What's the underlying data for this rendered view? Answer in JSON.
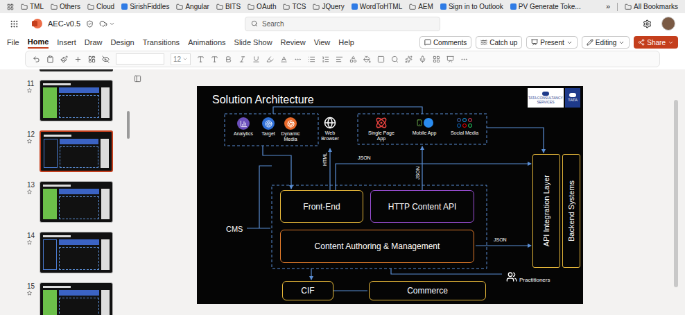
{
  "browser": {
    "bookmarks": [
      {
        "label": "TML",
        "kind": "folder"
      },
      {
        "label": "Others",
        "kind": "folder"
      },
      {
        "label": "Cloud",
        "kind": "folder"
      },
      {
        "label": "SirishFiddles",
        "kind": "site"
      },
      {
        "label": "Angular",
        "kind": "folder"
      },
      {
        "label": "BITS",
        "kind": "folder"
      },
      {
        "label": "OAuth",
        "kind": "folder"
      },
      {
        "label": "TCS",
        "kind": "folder"
      },
      {
        "label": "JQuery",
        "kind": "folder"
      },
      {
        "label": "WordToHTML",
        "kind": "site"
      },
      {
        "label": "AEM",
        "kind": "folder"
      },
      {
        "label": "Sign in to Outlook",
        "kind": "site"
      },
      {
        "label": "PV Generate Toke...",
        "kind": "site"
      }
    ],
    "overflow": "»",
    "all_bookmarks": "All Bookmarks"
  },
  "app": {
    "file_name": "AEC-v0.5",
    "search_placeholder": "Search"
  },
  "menu": {
    "tabs": [
      {
        "label": "File",
        "selected": false
      },
      {
        "label": "Home",
        "selected": true
      },
      {
        "label": "Insert",
        "selected": false
      },
      {
        "label": "Draw",
        "selected": false
      },
      {
        "label": "Design",
        "selected": false
      },
      {
        "label": "Transitions",
        "selected": false
      },
      {
        "label": "Animations",
        "selected": false
      },
      {
        "label": "Slide Show",
        "selected": false
      },
      {
        "label": "Review",
        "selected": false
      },
      {
        "label": "View",
        "selected": false
      },
      {
        "label": "Help",
        "selected": false
      }
    ],
    "actions": [
      {
        "label": "Comments",
        "kind": "plain"
      },
      {
        "label": "Catch up",
        "kind": "plain"
      },
      {
        "label": "Present",
        "kind": "dropdown"
      },
      {
        "label": "Editing",
        "kind": "dropdown"
      },
      {
        "label": "Share",
        "kind": "primary"
      }
    ]
  },
  "ribbon": {
    "font_size": "12"
  },
  "thumbnails": [
    {
      "number": "11",
      "selected": false
    },
    {
      "number": "12",
      "selected": true
    },
    {
      "number": "13",
      "selected": false
    },
    {
      "number": "14",
      "selected": false
    },
    {
      "number": "15",
      "selected": false
    }
  ],
  "slide": {
    "title": "Solution Architecture",
    "logos": [
      "TATA CONSULTANCY SERVICES",
      "TATA"
    ],
    "marketing_tools": [
      {
        "label": "Analytics",
        "color": "#6b4fbb"
      },
      {
        "label": "Target",
        "color": "#2f6fd6"
      },
      {
        "label": "Dynamic Media",
        "color": "#e8692a"
      }
    ],
    "web_browser": "Web Browser",
    "channels": [
      {
        "label": "Single Page App"
      },
      {
        "label": "Mobile App"
      },
      {
        "label": "Social Media"
      }
    ],
    "cms_label": "CMS",
    "blocks": [
      {
        "label": "Front-End",
        "color": "#e8b93a"
      },
      {
        "label": "HTTP Content API",
        "color": "#9b4fd6"
      },
      {
        "label": "Content Authoring & Management",
        "color": "#e07a2a"
      },
      {
        "label": "CIF",
        "color": "#e8b93a"
      },
      {
        "label": "Commerce",
        "color": "#e8b93a"
      }
    ],
    "side_layers": [
      {
        "label": "API Integration Layer"
      },
      {
        "label": "Backend Systems"
      }
    ],
    "practitioners": "Practitioners",
    "connector_labels": [
      {
        "label": "HTML",
        "vertical": true
      },
      {
        "label": "JSON",
        "vertical": false
      },
      {
        "label": "JSON",
        "vertical": true
      },
      {
        "label": "JSON",
        "vertical": false
      }
    ]
  }
}
